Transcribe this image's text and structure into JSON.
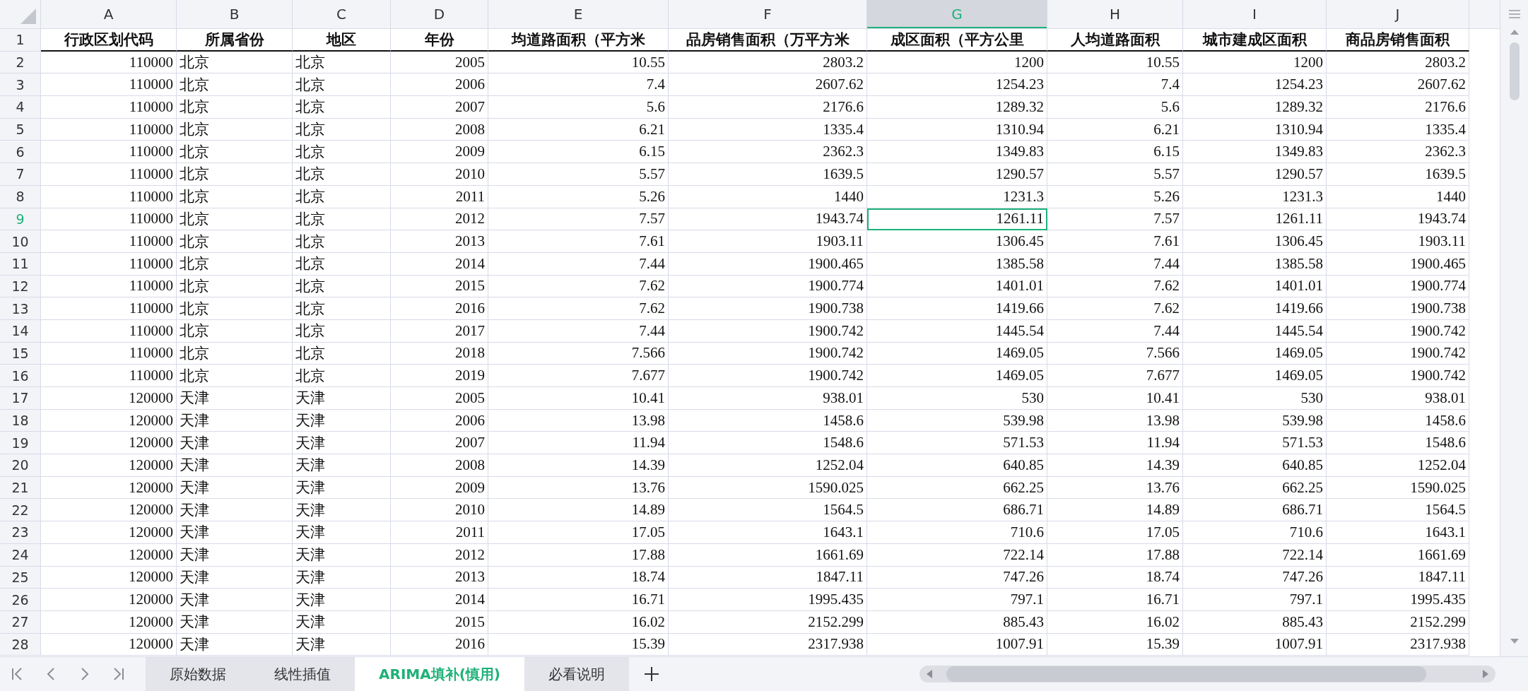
{
  "columns": [
    {
      "letter": "A",
      "kind": "number",
      "selected": false
    },
    {
      "letter": "B",
      "kind": "text",
      "selected": false
    },
    {
      "letter": "C",
      "kind": "text",
      "selected": false
    },
    {
      "letter": "D",
      "kind": "number",
      "selected": false
    },
    {
      "letter": "E",
      "kind": "number",
      "selected": false
    },
    {
      "letter": "F",
      "kind": "number",
      "selected": false
    },
    {
      "letter": "G",
      "kind": "number",
      "selected": true
    },
    {
      "letter": "H",
      "kind": "number",
      "selected": false
    },
    {
      "letter": "I",
      "kind": "number",
      "selected": false
    },
    {
      "letter": "J",
      "kind": "number",
      "selected": false
    }
  ],
  "rows": [
    {
      "number": "1",
      "kind": "header",
      "selected": false,
      "cells": [
        "行政区划代码",
        "所属省份",
        "地区",
        "年份",
        "均道路面积（平方米",
        "品房销售面积（万平方米",
        "成区面积（平方公里",
        "人均道路面积",
        "城市建成区面积",
        "商品房销售面积"
      ]
    },
    {
      "number": "2",
      "kind": "data",
      "selected": false,
      "cells": [
        "110000",
        "北京",
        "北京",
        "2005",
        "10.55",
        "2803.2",
        "1200",
        "10.55",
        "1200",
        "2803.2"
      ]
    },
    {
      "number": "3",
      "kind": "data",
      "selected": false,
      "cells": [
        "110000",
        "北京",
        "北京",
        "2006",
        "7.4",
        "2607.62",
        "1254.23",
        "7.4",
        "1254.23",
        "2607.62"
      ]
    },
    {
      "number": "4",
      "kind": "data",
      "selected": false,
      "cells": [
        "110000",
        "北京",
        "北京",
        "2007",
        "5.6",
        "2176.6",
        "1289.32",
        "5.6",
        "1289.32",
        "2176.6"
      ]
    },
    {
      "number": "5",
      "kind": "data",
      "selected": false,
      "cells": [
        "110000",
        "北京",
        "北京",
        "2008",
        "6.21",
        "1335.4",
        "1310.94",
        "6.21",
        "1310.94",
        "1335.4"
      ]
    },
    {
      "number": "6",
      "kind": "data",
      "selected": false,
      "cells": [
        "110000",
        "北京",
        "北京",
        "2009",
        "6.15",
        "2362.3",
        "1349.83",
        "6.15",
        "1349.83",
        "2362.3"
      ]
    },
    {
      "number": "7",
      "kind": "data",
      "selected": false,
      "cells": [
        "110000",
        "北京",
        "北京",
        "2010",
        "5.57",
        "1639.5",
        "1290.57",
        "5.57",
        "1290.57",
        "1639.5"
      ]
    },
    {
      "number": "8",
      "kind": "data",
      "selected": false,
      "cells": [
        "110000",
        "北京",
        "北京",
        "2011",
        "5.26",
        "1440",
        "1231.3",
        "5.26",
        "1231.3",
        "1440"
      ]
    },
    {
      "number": "9",
      "kind": "data",
      "selected": true,
      "cells": [
        "110000",
        "北京",
        "北京",
        "2012",
        "7.57",
        "1943.74",
        "1261.11",
        "7.57",
        "1261.11",
        "1943.74"
      ]
    },
    {
      "number": "10",
      "kind": "data",
      "selected": false,
      "cells": [
        "110000",
        "北京",
        "北京",
        "2013",
        "7.61",
        "1903.11",
        "1306.45",
        "7.61",
        "1306.45",
        "1903.11"
      ]
    },
    {
      "number": "11",
      "kind": "data",
      "selected": false,
      "cells": [
        "110000",
        "北京",
        "北京",
        "2014",
        "7.44",
        "1900.465",
        "1385.58",
        "7.44",
        "1385.58",
        "1900.465"
      ]
    },
    {
      "number": "12",
      "kind": "data",
      "selected": false,
      "cells": [
        "110000",
        "北京",
        "北京",
        "2015",
        "7.62",
        "1900.774",
        "1401.01",
        "7.62",
        "1401.01",
        "1900.774"
      ]
    },
    {
      "number": "13",
      "kind": "data",
      "selected": false,
      "cells": [
        "110000",
        "北京",
        "北京",
        "2016",
        "7.62",
        "1900.738",
        "1419.66",
        "7.62",
        "1419.66",
        "1900.738"
      ]
    },
    {
      "number": "14",
      "kind": "data",
      "selected": false,
      "cells": [
        "110000",
        "北京",
        "北京",
        "2017",
        "7.44",
        "1900.742",
        "1445.54",
        "7.44",
        "1445.54",
        "1900.742"
      ]
    },
    {
      "number": "15",
      "kind": "data",
      "selected": false,
      "cells": [
        "110000",
        "北京",
        "北京",
        "2018",
        "7.566",
        "1900.742",
        "1469.05",
        "7.566",
        "1469.05",
        "1900.742"
      ]
    },
    {
      "number": "16",
      "kind": "data",
      "selected": false,
      "cells": [
        "110000",
        "北京",
        "北京",
        "2019",
        "7.677",
        "1900.742",
        "1469.05",
        "7.677",
        "1469.05",
        "1900.742"
      ]
    },
    {
      "number": "17",
      "kind": "data",
      "selected": false,
      "cells": [
        "120000",
        "天津",
        "天津",
        "2005",
        "10.41",
        "938.01",
        "530",
        "10.41",
        "530",
        "938.01"
      ]
    },
    {
      "number": "18",
      "kind": "data",
      "selected": false,
      "cells": [
        "120000",
        "天津",
        "天津",
        "2006",
        "13.98",
        "1458.6",
        "539.98",
        "13.98",
        "539.98",
        "1458.6"
      ]
    },
    {
      "number": "19",
      "kind": "data",
      "selected": false,
      "cells": [
        "120000",
        "天津",
        "天津",
        "2007",
        "11.94",
        "1548.6",
        "571.53",
        "11.94",
        "571.53",
        "1548.6"
      ]
    },
    {
      "number": "20",
      "kind": "data",
      "selected": false,
      "cells": [
        "120000",
        "天津",
        "天津",
        "2008",
        "14.39",
        "1252.04",
        "640.85",
        "14.39",
        "640.85",
        "1252.04"
      ]
    },
    {
      "number": "21",
      "kind": "data",
      "selected": false,
      "cells": [
        "120000",
        "天津",
        "天津",
        "2009",
        "13.76",
        "1590.025",
        "662.25",
        "13.76",
        "662.25",
        "1590.025"
      ]
    },
    {
      "number": "22",
      "kind": "data",
      "selected": false,
      "cells": [
        "120000",
        "天津",
        "天津",
        "2010",
        "14.89",
        "1564.5",
        "686.71",
        "14.89",
        "686.71",
        "1564.5"
      ]
    },
    {
      "number": "23",
      "kind": "data",
      "selected": false,
      "cells": [
        "120000",
        "天津",
        "天津",
        "2011",
        "17.05",
        "1643.1",
        "710.6",
        "17.05",
        "710.6",
        "1643.1"
      ]
    },
    {
      "number": "24",
      "kind": "data",
      "selected": false,
      "cells": [
        "120000",
        "天津",
        "天津",
        "2012",
        "17.88",
        "1661.69",
        "722.14",
        "17.88",
        "722.14",
        "1661.69"
      ]
    },
    {
      "number": "25",
      "kind": "data",
      "selected": false,
      "cells": [
        "120000",
        "天津",
        "天津",
        "2013",
        "18.74",
        "1847.11",
        "747.26",
        "18.74",
        "747.26",
        "1847.11"
      ]
    },
    {
      "number": "26",
      "kind": "data",
      "selected": false,
      "cells": [
        "120000",
        "天津",
        "天津",
        "2014",
        "16.71",
        "1995.435",
        "797.1",
        "16.71",
        "797.1",
        "1995.435"
      ]
    },
    {
      "number": "27",
      "kind": "data",
      "selected": false,
      "cells": [
        "120000",
        "天津",
        "天津",
        "2015",
        "16.02",
        "2152.299",
        "885.43",
        "16.02",
        "885.43",
        "2152.299"
      ]
    },
    {
      "number": "28",
      "kind": "data",
      "selected": false,
      "cells": [
        "120000",
        "天津",
        "天津",
        "2016",
        "15.39",
        "2317.938",
        "1007.91",
        "15.39",
        "1007.91",
        "2317.938"
      ]
    }
  ],
  "sheet_tabs": [
    {
      "label": "原始数据",
      "selected": false
    },
    {
      "label": "线性插值",
      "selected": false
    },
    {
      "label": "ARIMA填补(慎用)",
      "selected": true
    },
    {
      "label": "必看说明",
      "selected": false
    }
  ]
}
